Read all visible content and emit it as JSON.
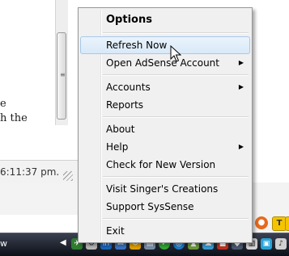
{
  "document": {
    "line1": "e",
    "line2": "h the",
    "status_time": "6:11:37 pm."
  },
  "menu": {
    "title": "Options",
    "items": [
      {
        "label": "Refresh Now",
        "submenu": false,
        "highlighted": true
      },
      {
        "label": "Open AdSense Account",
        "submenu": true
      },
      {
        "label": "Accounts",
        "submenu": true
      },
      {
        "label": "Reports",
        "submenu": false
      },
      {
        "label": "About",
        "submenu": false
      },
      {
        "label": "Help",
        "submenu": true
      },
      {
        "label": "Check for New Version",
        "submenu": false
      },
      {
        "label": "Visit Singer's Creations",
        "submenu": false
      },
      {
        "label": "Support SysSense",
        "submenu": false
      },
      {
        "label": "Exit",
        "submenu": false
      }
    ],
    "arrow_glyph": "▶"
  },
  "taskbar": {
    "label": "w",
    "tray_arrow": "◀",
    "tray_icons": [
      "linkedin-icon",
      "mail-icon",
      "sync-icon",
      "check-icon",
      "globe-icon",
      "network-icon",
      "volume-icon",
      "app-icon"
    ]
  },
  "toolbar_icons": [
    "firefox-icon",
    "toolbar-app-icon",
    "toolbar-app2-icon"
  ],
  "colors": {
    "menu_bg": "#f0f0f0",
    "highlight": "#d9e9f8",
    "taskbar": "#1a1e29"
  }
}
